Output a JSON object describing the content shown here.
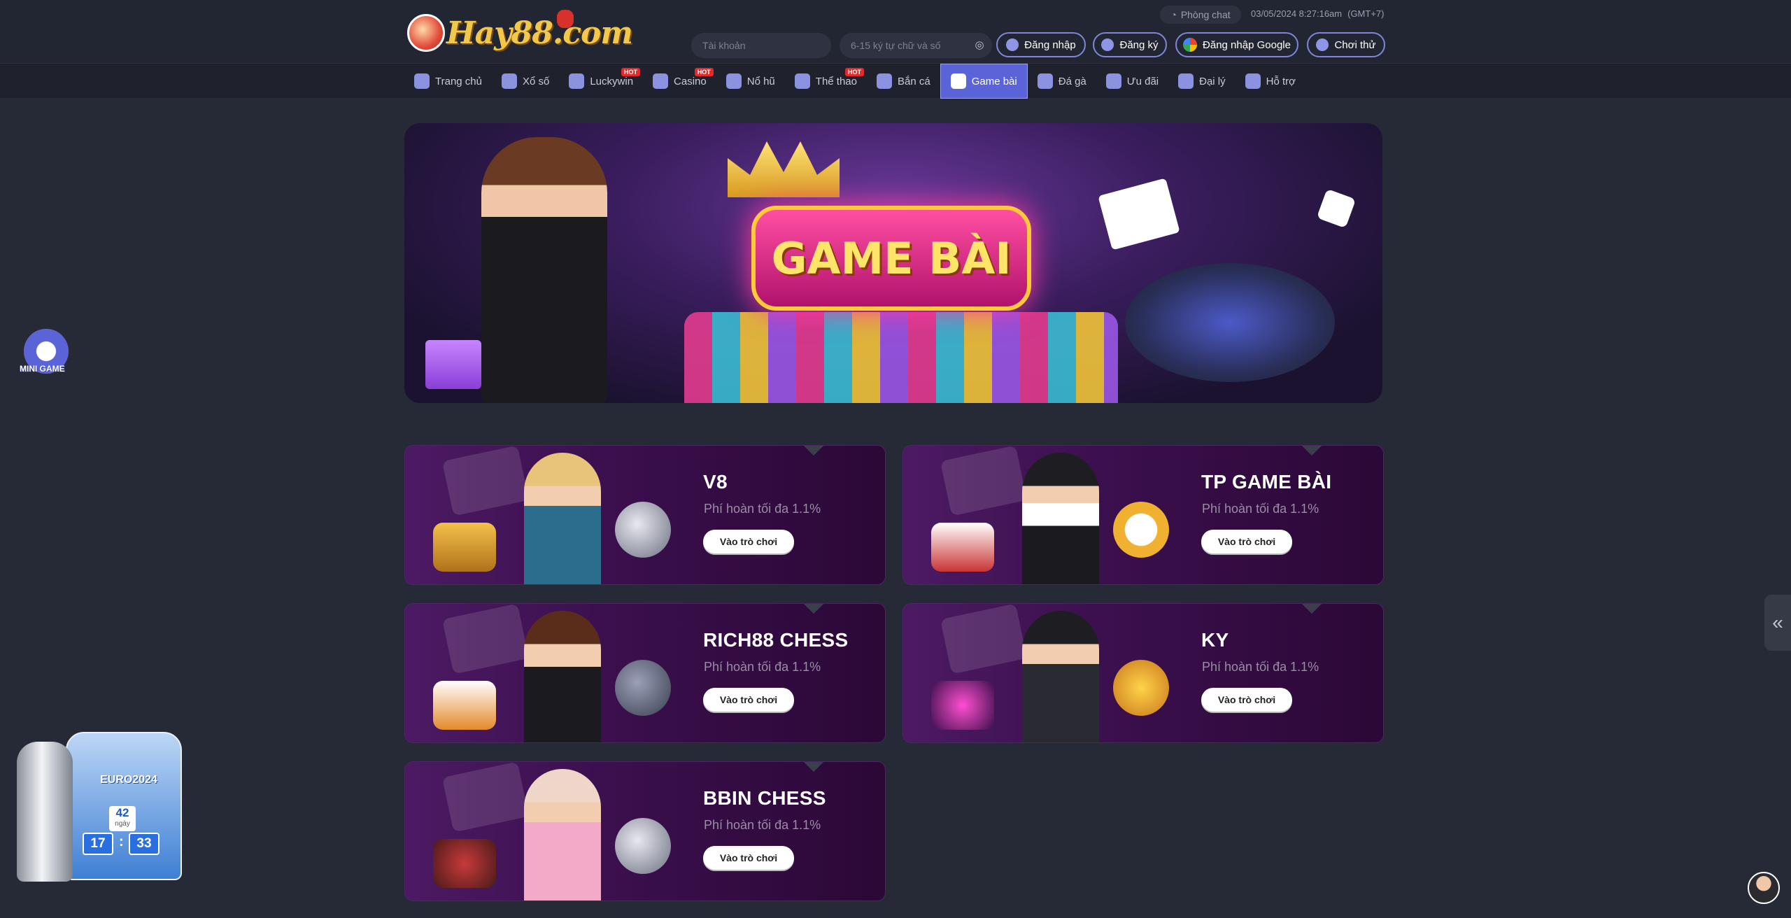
{
  "header": {
    "logo_text": "Hay88.com",
    "chat_label": "Phòng chat",
    "datetime": "03/05/2024 8:27:16am",
    "timezone": "(GMT+7)",
    "username_placeholder": "Tài khoản",
    "password_placeholder": "6-15 ký tự chữ và số",
    "login_label": "Đăng nhập",
    "register_label": "Đăng ký",
    "google_label": "Đăng nhập Google",
    "trial_label": "Chơi thử"
  },
  "nav": {
    "items": [
      {
        "label": "Trang chủ",
        "hot": ""
      },
      {
        "label": "Xổ số",
        "hot": ""
      },
      {
        "label": "Luckywin",
        "hot": "HOT"
      },
      {
        "label": "Casino",
        "hot": "HOT"
      },
      {
        "label": "Nổ hũ",
        "hot": ""
      },
      {
        "label": "Thể thao",
        "hot": "HOT"
      },
      {
        "label": "Bắn cá",
        "hot": ""
      },
      {
        "label": "Game bài",
        "hot": ""
      },
      {
        "label": "Đá gà",
        "hot": ""
      },
      {
        "label": "Ưu đãi",
        "hot": ""
      },
      {
        "label": "Đại lý",
        "hot": ""
      },
      {
        "label": "Hỗ trợ",
        "hot": ""
      }
    ],
    "active_index": 7
  },
  "banner": {
    "title": "GAME BÀI"
  },
  "games": [
    {
      "title": "V8",
      "subtitle": "Phí hoàn tối đa 1.1%",
      "button": "Vào trò chơi"
    },
    {
      "title": "TP GAME BÀI",
      "subtitle": "Phí hoàn tối đa 1.1%",
      "button": "Vào trò chơi"
    },
    {
      "title": "RICH88 CHESS",
      "subtitle": "Phí hoàn tối đa 1.1%",
      "button": "Vào trò chơi"
    },
    {
      "title": "KY",
      "subtitle": "Phí hoàn tối đa 1.1%",
      "button": "Vào trò chơi"
    },
    {
      "title": "BBIN CHESS",
      "subtitle": "Phí hoàn tối đa 1.1%",
      "button": "Vào trò chơi"
    }
  ],
  "widgets": {
    "minigame_label": "MINI GAME",
    "euro_title": "EURO2024",
    "euro_days": "42",
    "euro_days_label": "ngày",
    "euro_hours": "17",
    "euro_minutes": "33"
  },
  "colors": {
    "background": "#262a36",
    "accent": "#5a63d8",
    "hot_badge": "#e22a2a",
    "card_bg": "#3a0f4c"
  }
}
